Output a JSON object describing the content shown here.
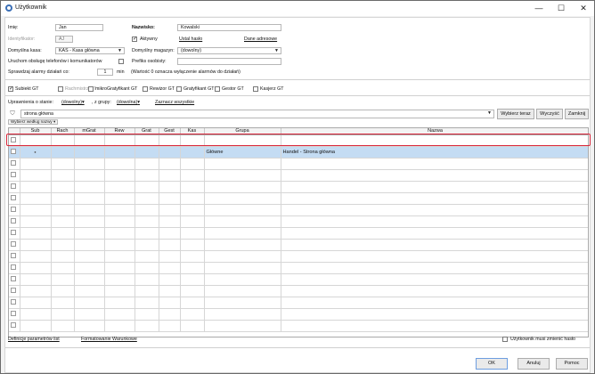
{
  "window": {
    "title": "Użytkownik",
    "min": "—",
    "max": "☐",
    "close": "✕"
  },
  "form": {
    "imie_label": "Imię:",
    "imie_value": "Jan",
    "identyfikator_label": "Identyfikator:",
    "identyfikator_value": "AJ",
    "kasa_label": "Domyślna kasa:",
    "kasa_value": "KAS - Kasa główna",
    "telefon_label": "Uruchom obsługę telefonów i komunikatorów",
    "alarm_label": "Sprawdzaj alarmy działań co:",
    "alarm_value": "1",
    "alarm_unit": "min",
    "alarm_note": "(Wartość 0 oznacza wyłączenie alarmów do działań)",
    "nazwisko_label": "Nazwisko:",
    "nazwisko_value": "Kowalski",
    "aktywny_label": "Aktywny",
    "ustal_haslo": "Ustal hasło",
    "dane_adresowe": "Dane adresowe",
    "magazyn_label": "Domyślny magazyn:",
    "magazyn_value": "(dowolny)",
    "prefiks_label": "Prefiks osobisty:",
    "prefiks_value": ""
  },
  "modules": [
    {
      "label": "Subiekt GT",
      "checked": true,
      "enabled": true
    },
    {
      "label": "Rachmistrz GT",
      "checked": false,
      "enabled": false
    },
    {
      "label": "mikroGratyfikant GT",
      "checked": false,
      "enabled": true
    },
    {
      "label": "Rewizor GT",
      "checked": false,
      "enabled": true
    },
    {
      "label": "Gratyfikant GT",
      "checked": false,
      "enabled": true
    },
    {
      "label": "Gestor GT",
      "checked": false,
      "enabled": true
    },
    {
      "label": "Kasjerz GT",
      "checked": false,
      "enabled": true
    }
  ],
  "filter": {
    "uprawnienia_label": "Uprawnienia o stanie:",
    "stan_value": "(dowolny)",
    "grupy_label": ", z grupy:",
    "grupa_value": "(dowolna)",
    "zaznacz": "Zaznacz wszystkie"
  },
  "search": {
    "value": "strona główna",
    "wybierz": "Wybierz teraz",
    "wyczysc": "Wyczyść",
    "zamknij": "Zamknij",
    "mode": "Wybierz według nazwy"
  },
  "grid": {
    "headers": [
      "",
      "Sub",
      "Rach",
      "mGrat",
      "Rew",
      "Grat",
      "Gest",
      "Kas",
      "Grupa",
      "Nazwa"
    ],
    "rows": [
      {
        "sub": "●",
        "grupa": "Główne",
        "nazwa": "Handel - Strona główna"
      }
    ],
    "empty_rows": 15
  },
  "footer": {
    "definicje": "Definicje parametrów list",
    "formatowanie": "Formatowanie Warunkowe",
    "musi_zmienic": "Użytkownik musi zmienić hasło",
    "ok": "OK",
    "anuluj": "Anuluj",
    "pomoc": "Pomoc"
  }
}
